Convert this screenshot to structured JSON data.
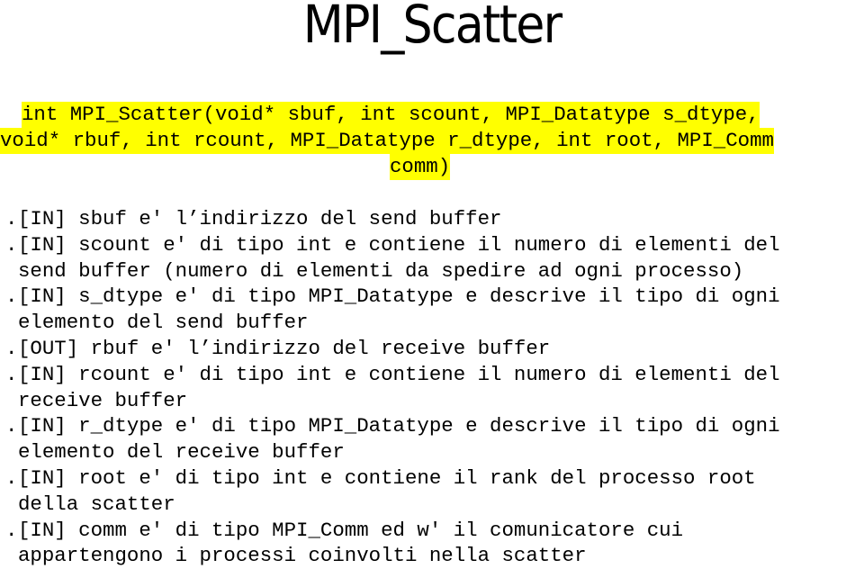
{
  "title": "MPI_Scatter",
  "signature": {
    "lines": [
      "int MPI_Scatter(void* sbuf, int scount, MPI_Datatype s_dtype,",
      "void* rbuf, int rcount, MPI_Datatype r_dtype, int root, MPI_Comm",
      "comm)"
    ],
    "highlight_color": "#ffff00"
  },
  "params": [
    {
      "bullet": ".",
      "lines": [
        "[IN] sbuf e' l’indirizzo del send buffer"
      ]
    },
    {
      "bullet": ".",
      "lines": [
        "[IN] scount e' di tipo int e contiene il numero di elementi del",
        "send buffer (numero di elementi da spedire ad ogni processo)"
      ]
    },
    {
      "bullet": ".",
      "lines": [
        "[IN] s_dtype e' di tipo MPI_Datatype e descrive il tipo di ogni",
        "elemento del send buffer"
      ]
    },
    {
      "bullet": ".",
      "lines": [
        "[OUT] rbuf e' l’indirizzo del receive buffer"
      ]
    },
    {
      "bullet": ".",
      "lines": [
        "[IN] rcount e' di tipo int e contiene il numero di elementi del",
        "receive buffer"
      ]
    },
    {
      "bullet": ".",
      "lines": [
        "[IN] r_dtype e' di tipo MPI_Datatype e descrive il tipo di ogni",
        "elemento del receive buffer"
      ]
    },
    {
      "bullet": ".",
      "lines": [
        "[IN] root e' di tipo int e contiene il rank del processo root",
        "della scatter"
      ]
    },
    {
      "bullet": ".",
      "lines": [
        "[IN] comm e' di tipo MPI_Comm ed w' il comunicatore cui",
        "appartengono i processi coinvolti nella scatter"
      ]
    }
  ]
}
